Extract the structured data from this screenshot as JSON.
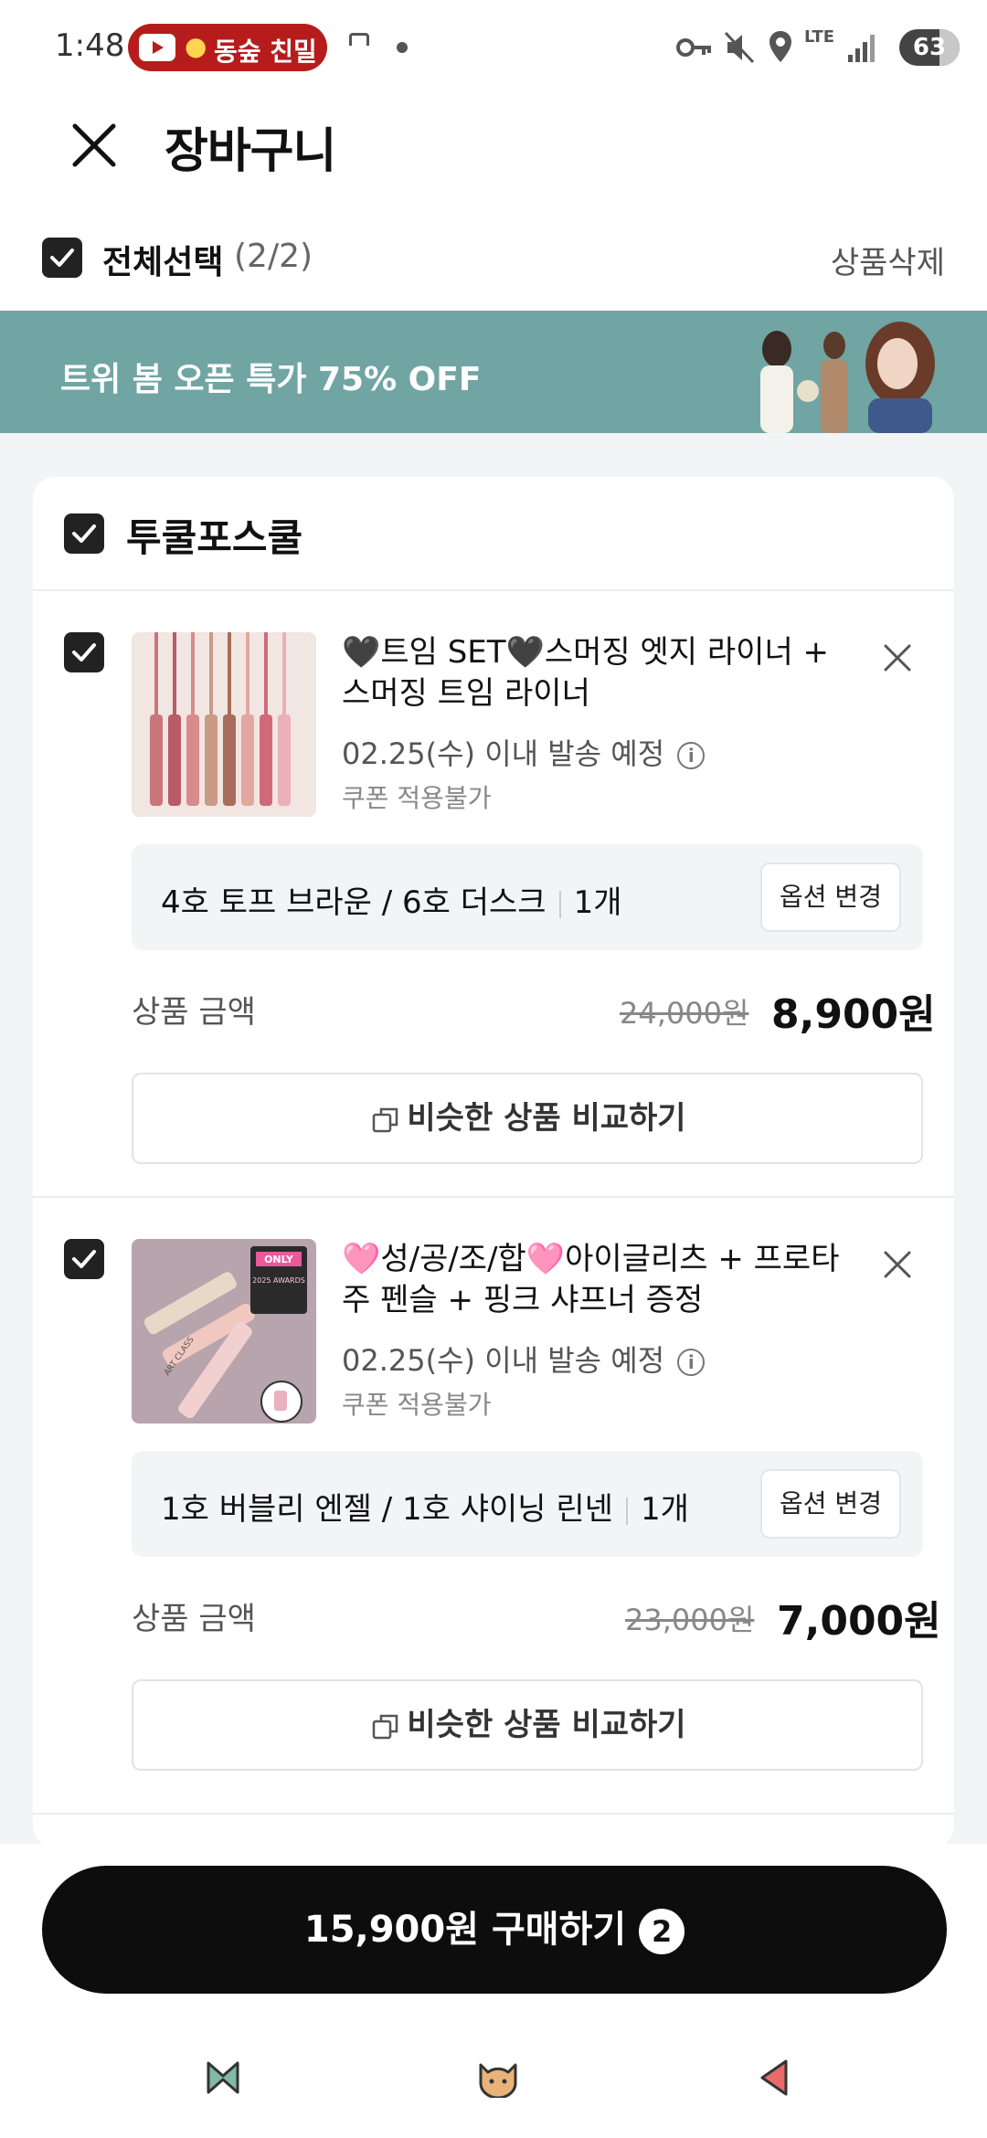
{
  "status_bar": {
    "time": "1:48",
    "notification_text": "동숲 친밀",
    "lte": "LTE",
    "battery": "63"
  },
  "header": {
    "title": "장바구니"
  },
  "select_bar": {
    "label": "전체선택",
    "count": "(2/2)",
    "delete_label": "상품삭제"
  },
  "banner": {
    "text": "트위 봄 오픈 특가 75% OFF"
  },
  "store": {
    "name": "투쿨포스쿨"
  },
  "items": [
    {
      "title": "🖤트임 SET🖤스머징 엣지 라이너 + 스머징 트임 라이너",
      "ship_date": "02.25(수) 이내 발송 예정",
      "coupon": "쿠폰 적용불가",
      "option": "4호 토프 브라운 / 6호 더스크",
      "qty": "1개",
      "option_btn": "옵션 변경",
      "price_label": "상품 금액",
      "original_price": "24,000원",
      "final_price": "8,900원",
      "compare_label": "비슷한 상품 비교하기"
    },
    {
      "title": "🩷성/공/조/합🩷아이글리츠 + 프로타주 펜슬 + 핑크 샤프너 증정",
      "ship_date": "02.25(수) 이내 발송 예정",
      "coupon": "쿠폰 적용불가",
      "option": "1호 버블리 엔젤 / 1호 샤이닝 린넨",
      "qty": "1개",
      "option_btn": "옵션 변경",
      "price_label": "상품 금액",
      "original_price": "23,000원",
      "final_price": "7,000원",
      "compare_label": "비슷한 상품 비교하기"
    }
  ],
  "product_image_text": {
    "badge": "ONLY",
    "awards": "2025 AWARDS",
    "brand": "ART CLASS"
  },
  "buy": {
    "label": "15,900원 구매하기",
    "count": "2"
  },
  "colors": {
    "banner": "#70a5a3",
    "button": "#0d0d0d"
  }
}
